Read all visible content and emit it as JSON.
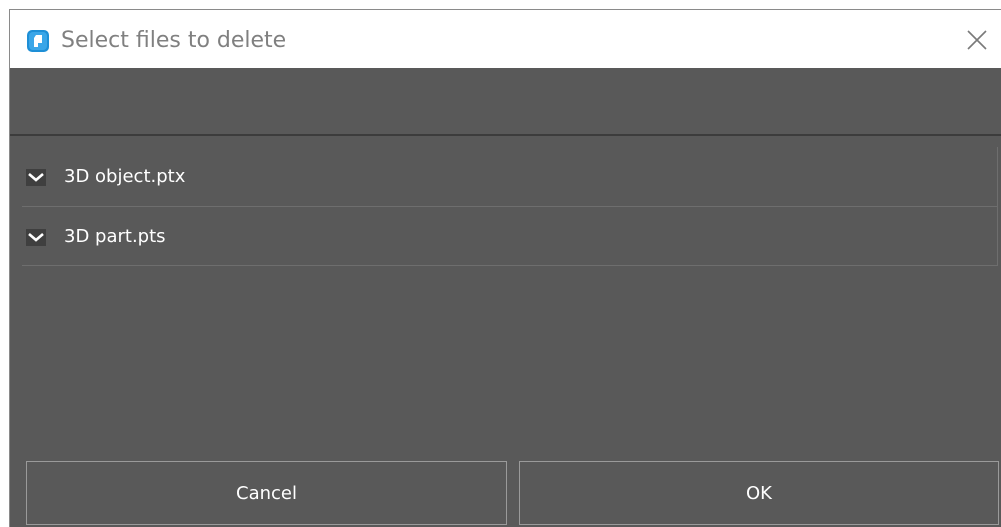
{
  "window": {
    "title": "Select files to delete"
  },
  "files": [
    {
      "name": "3D object.ptx",
      "checked": true
    },
    {
      "name": "3D part.pts",
      "checked": true
    }
  ],
  "buttons": {
    "cancel_label": "Cancel",
    "ok_label": "OK"
  },
  "icons": {
    "app": "app-icon",
    "close": "close-icon",
    "check": "check-icon"
  },
  "colors": {
    "body": "#595959",
    "titlebar": "#ffffff",
    "title_text": "#808080",
    "app_icon": "#1e8fd6",
    "text": "#ffffff"
  }
}
